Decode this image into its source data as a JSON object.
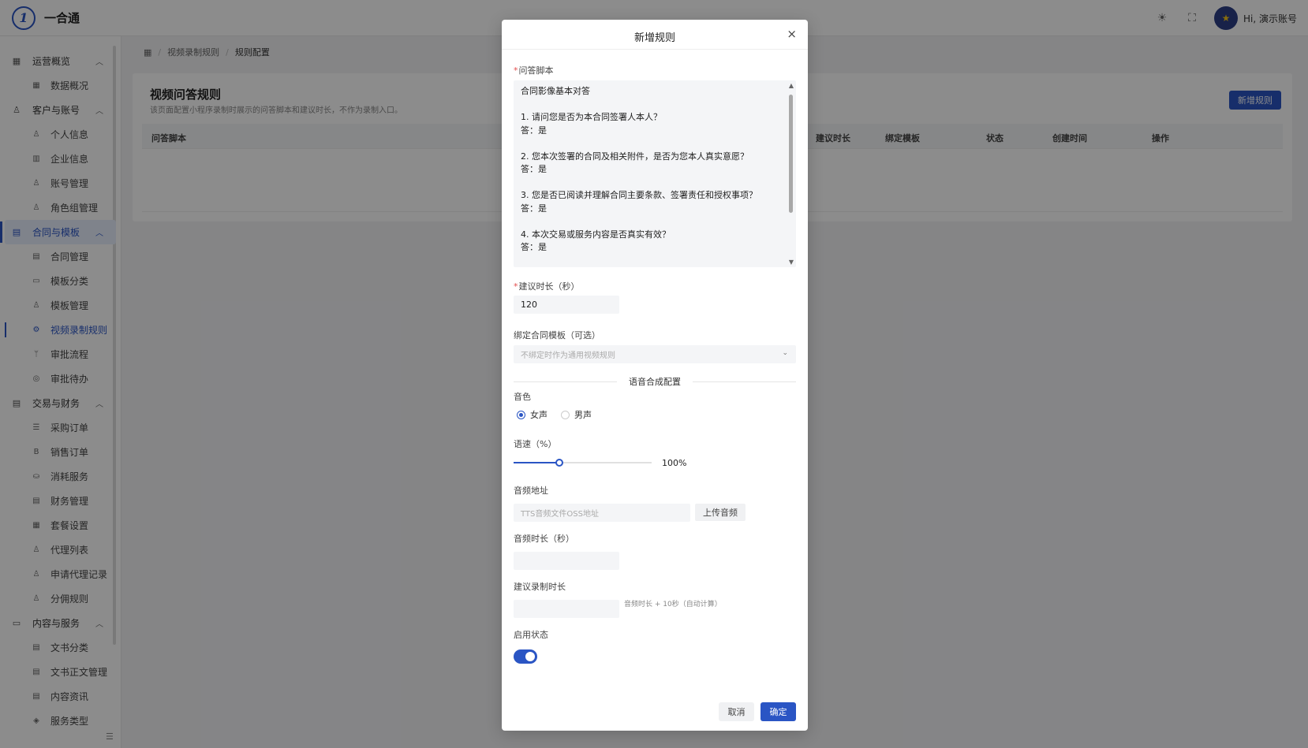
{
  "app": {
    "name": "一合通",
    "logo_icon": "logo-icon"
  },
  "header": {
    "greeting": "Hi, 演示账号"
  },
  "sidebar": {
    "groups": [
      {
        "label": "运营概览",
        "items": [
          "数据概况"
        ]
      },
      {
        "label": "客户与账号",
        "items": [
          "个人信息",
          "企业信息",
          "账号管理",
          "角色组管理"
        ]
      },
      {
        "label": "合同与模板",
        "active": true,
        "items": [
          "合同管理",
          "模板分类",
          "模板管理",
          "视频录制规则",
          "审批流程",
          "审批待办"
        ]
      },
      {
        "label": "交易与财务",
        "items": [
          "采购订单",
          "销售订单",
          "消耗服务",
          "财务管理",
          "套餐设置",
          "代理列表",
          "申请代理记录",
          "分佣规则"
        ]
      },
      {
        "label": "内容与服务",
        "items": [
          "文书分类",
          "文书正文管理",
          "内容资讯",
          "服务类型"
        ]
      }
    ],
    "active_item": "视频录制规则"
  },
  "breadcrumb": [
    "视频录制规则",
    "规则配置"
  ],
  "page": {
    "title": "视频问答规则",
    "subtitle": "该页面配置小程序录制时展示的问答脚本和建议时长，不作为录制入口。",
    "new_button": "新增规则",
    "columns": [
      "问答脚本",
      "建议时长",
      "绑定模板",
      "状态",
      "创建时间",
      "操作"
    ]
  },
  "modal": {
    "title": "新增规则",
    "close": "×",
    "script_label": "问答脚本",
    "script_text": "合同影像基本对答\n\n1. 请问您是否为本合同签署人本人？\n答：是\n\n2. 您本次签署的合同及相关附件，是否为您本人真实意愿？\n答：是\n\n3. 您是否已阅读并理解合同主要条款、签署责任和授权事项？\n答：是\n\n4. 本次交易或服务内容是否真实有效？\n答：是",
    "duration_label": "建议时长（秒）",
    "duration_value": "120",
    "template_label": "绑定合同模板（可选）",
    "template_placeholder": "不绑定时作为通用视频规则",
    "tts_section": "语音合成配置",
    "voice_label": "音色",
    "voice_options": [
      "女声",
      "男声"
    ],
    "voice_selected": "女声",
    "speed_label": "语速（%）",
    "speed_value": 100,
    "speed_text": "100%",
    "speed_fraction": 0.33,
    "audio_url_label": "音频地址",
    "audio_url_placeholder": "TTS音频文件OSS地址",
    "upload_button": "上传音频",
    "audio_duration_label": "音频时长（秒）",
    "record_duration_label": "建议录制时长",
    "record_hint": "音频时长 + 10秒（自动计算）",
    "status_label": "启用状态",
    "status_enabled": true,
    "cancel": "取消",
    "ok": "确定"
  },
  "colors": {
    "primary": "#2a55c4",
    "required": "#e34d4d"
  }
}
